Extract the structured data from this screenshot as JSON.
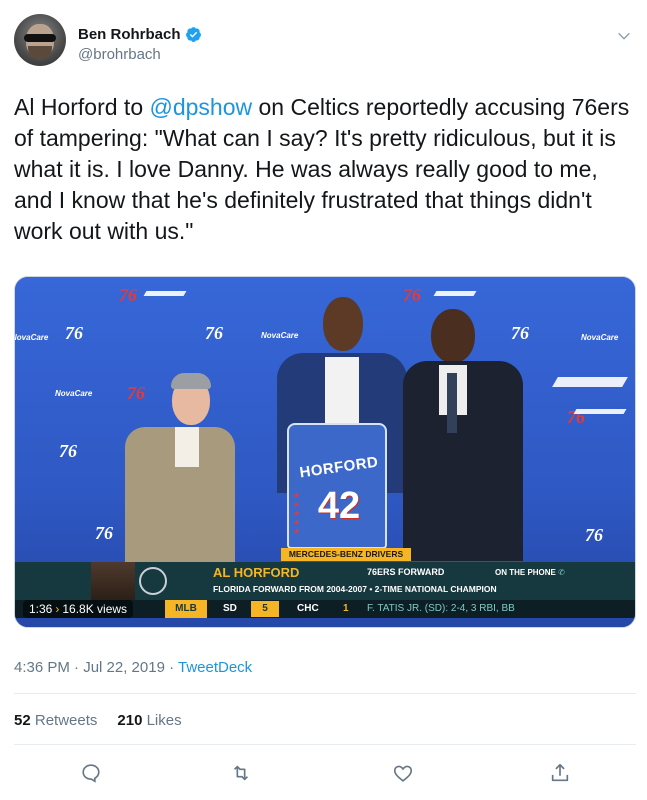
{
  "author": {
    "display_name": "Ben Rohrbach",
    "handle": "@brohrbach",
    "verified": true
  },
  "tweet": {
    "text_before": "Al Horford to ",
    "mention": "@dpshow",
    "text_after": " on Celtics reportedly accusing 76ers of tampering: \"What can I say? It's pretty ridiculous, but it is what it is. I love Danny. He was always really good to me, and I know that he's definitely frustrated that things didn't work out with us.\"",
    "timestamp": "4:36 PM · Jul 22, 2019 · ",
    "source": "TweetDeck"
  },
  "media": {
    "duration": "1:36",
    "views": "16.8K views",
    "jersey_name": "HORFORD",
    "jersey_number": "42",
    "logo_text": "76",
    "sponsor_text": "NovaCare",
    "lower_third": {
      "tag": "MERCEDES-BENZ DRIVERS SEAT",
      "name": "AL HORFORD",
      "role": "76ERS FORWARD",
      "subtitle": "FLORIDA FORWARD FROM 2004-2007 • 2-TIME NATIONAL CHAMPION",
      "phone": "ON THE PHONE"
    },
    "ticker": {
      "league": "MLB",
      "team1": "SD",
      "score1": "5",
      "team2": "CHC",
      "score2": "1",
      "note": "F. TATIS JR. (SD): 2-4, 3 RBI, BB"
    }
  },
  "stats": {
    "retweets_count": "52",
    "retweets_label": "Retweets",
    "likes_count": "210",
    "likes_label": "Likes"
  },
  "colors": {
    "link": "#1b95e0",
    "text_primary": "#14171a",
    "text_secondary": "#657786",
    "divider": "#e6ecf0",
    "sixers_blue": "#2f59c4",
    "nbc_gold": "#f6b524"
  },
  "icons": [
    "verified-badge-icon",
    "chevron-down-icon",
    "reply-icon",
    "retweet-icon",
    "like-icon",
    "share-icon"
  ]
}
